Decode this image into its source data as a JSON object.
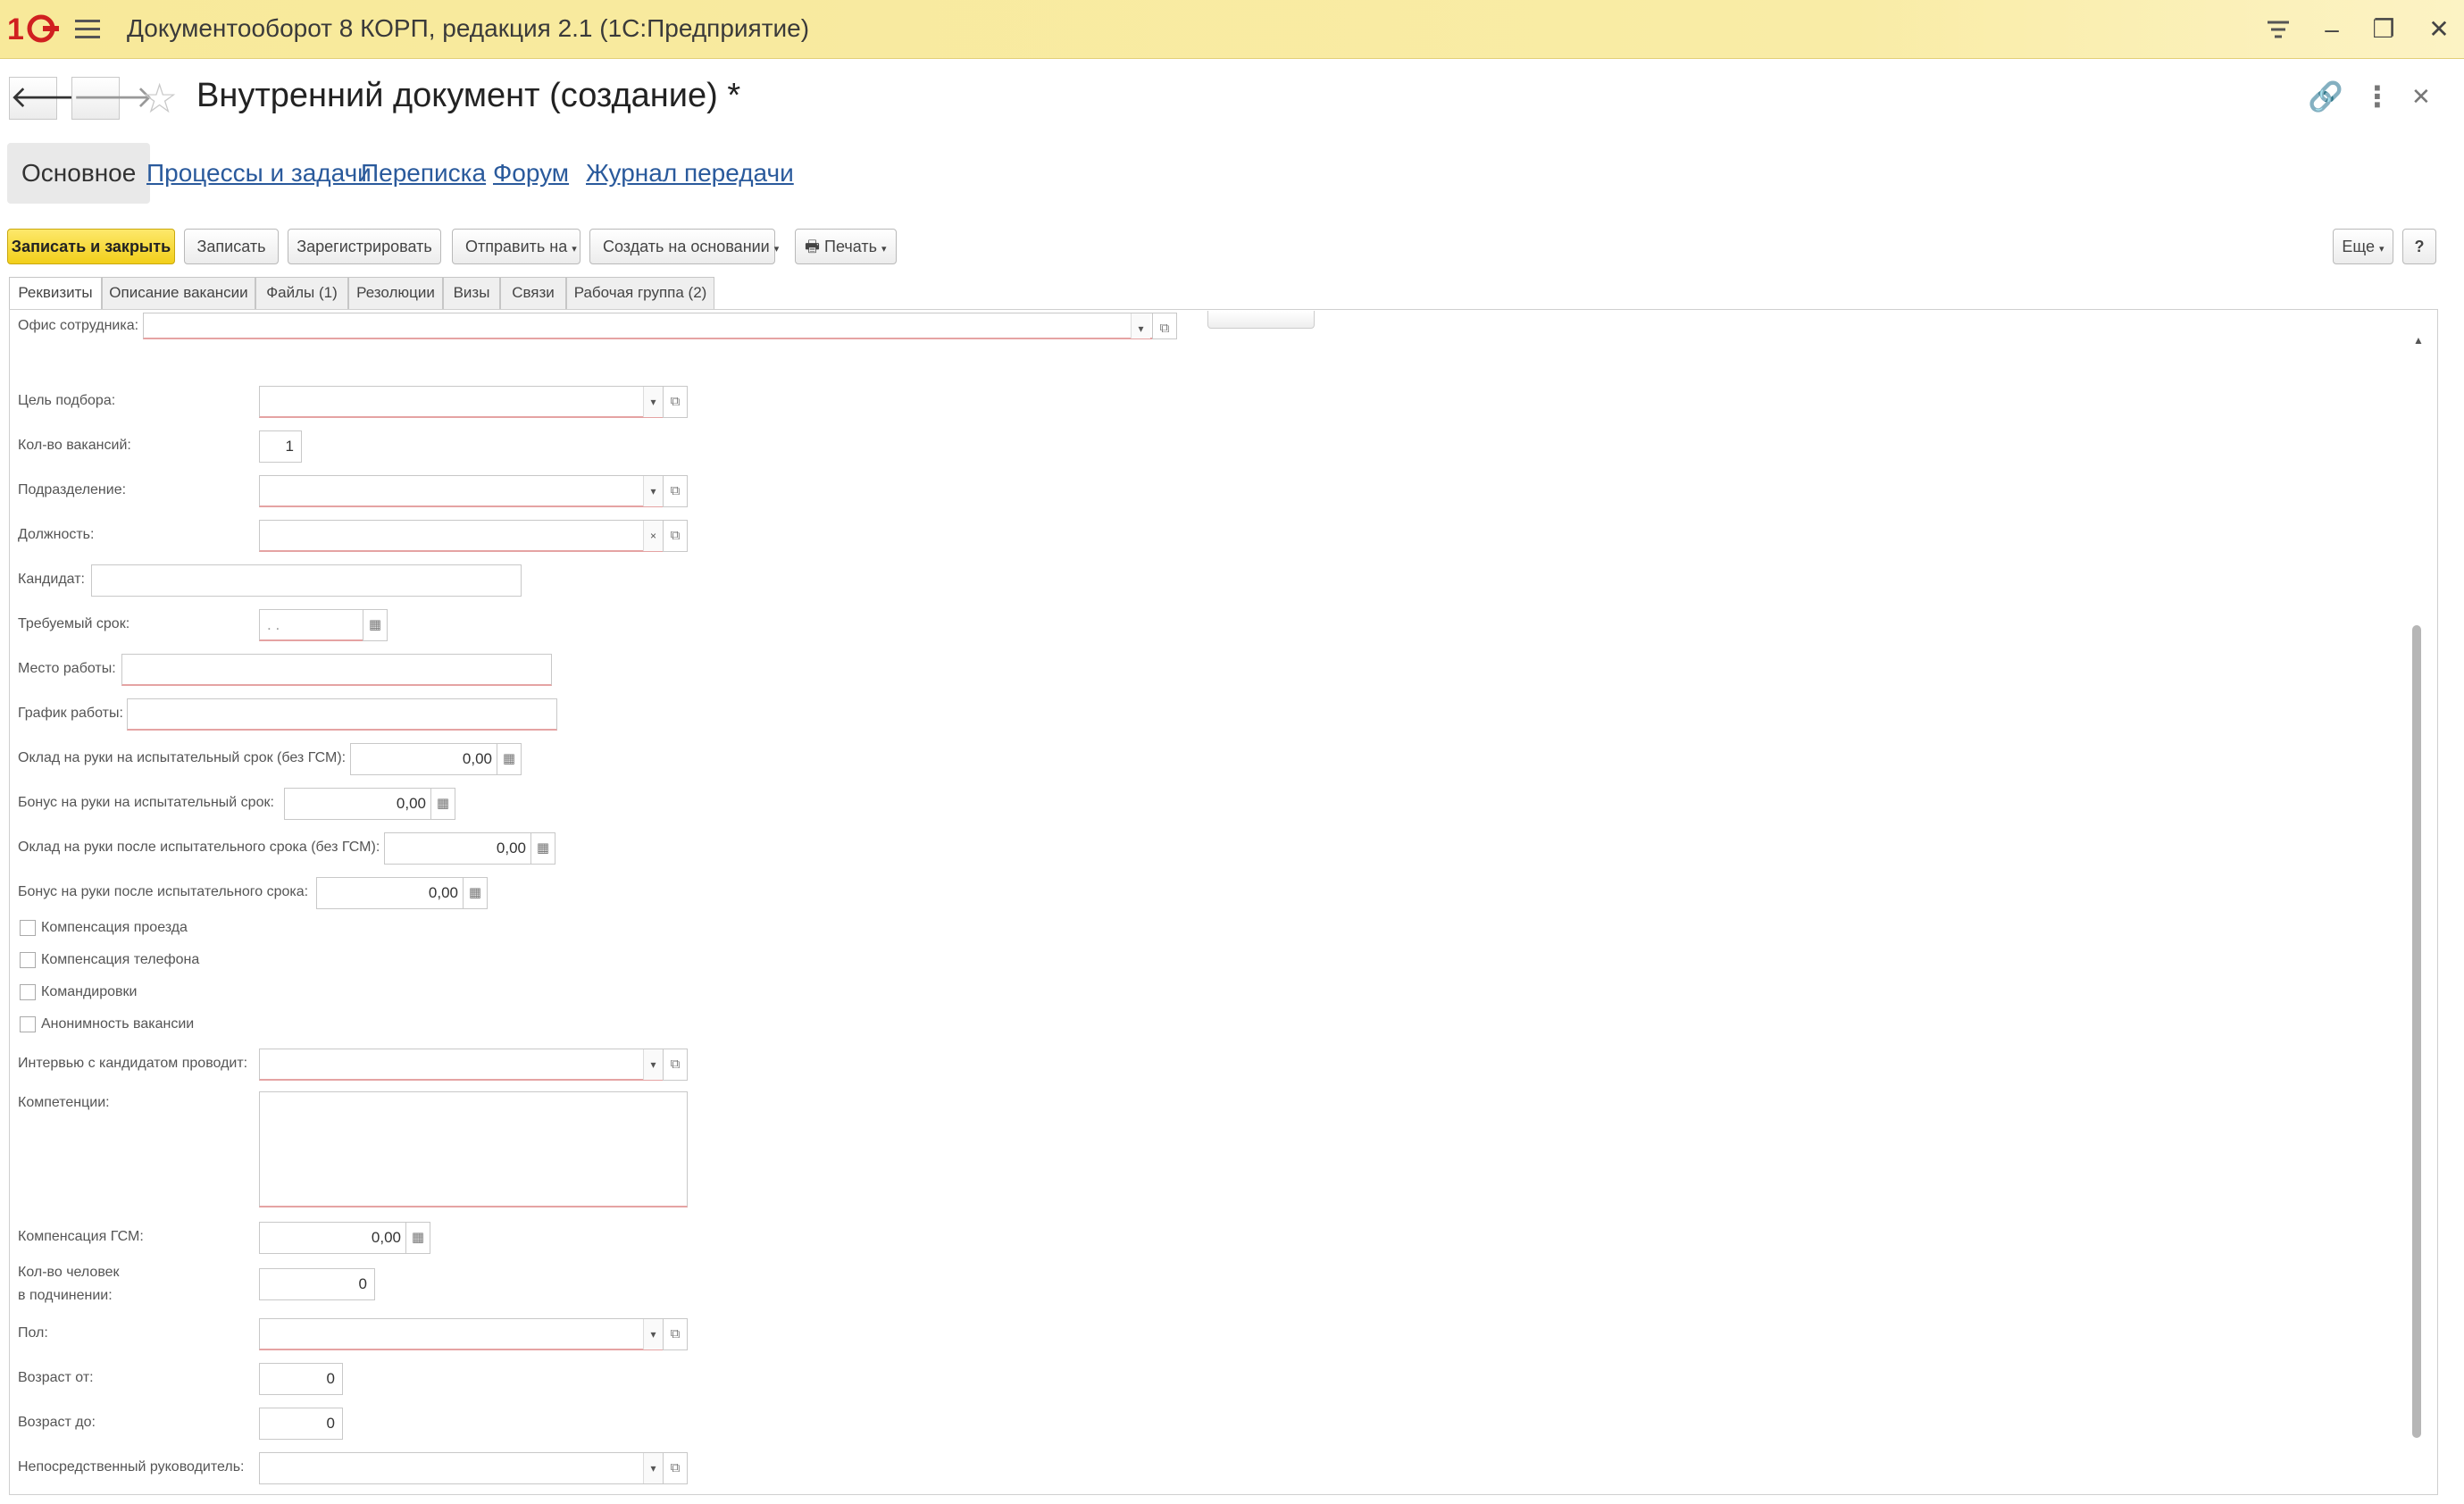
{
  "window": {
    "title": "Документооборот 8 КОРП, редакция 2.1  (1С:Предприятие)",
    "controls": [
      "hamburger-menu-icon",
      "minimize-icon",
      "restore-icon",
      "close-icon"
    ]
  },
  "header": {
    "title": "Внутренний документ (создание) *"
  },
  "section_tabs": [
    "Основное",
    "Процессы и задачи",
    "Переписка",
    "Форум",
    "Журнал передачи"
  ],
  "commands": {
    "save_close": "Записать и закрыть",
    "save": "Записать",
    "register": "Зарегистрировать",
    "send_to": "Отправить на",
    "create_based": "Создать на основании",
    "print": "Печать",
    "more": "Еще",
    "help": "?"
  },
  "form_tabs": [
    "Реквизиты",
    "Описание вакансии",
    "Файлы (1)",
    "Резолюции",
    "Визы",
    "Связи",
    "Рабочая группа (2)"
  ],
  "fields": {
    "office": {
      "label": "Офис сотрудника:",
      "value": ""
    },
    "goal": {
      "label": "Цель подбора:",
      "value": ""
    },
    "vacancies": {
      "label": "Кол-во вакансий:",
      "value": "1"
    },
    "department": {
      "label": "Подразделение:",
      "value": ""
    },
    "position": {
      "label": "Должность:",
      "value": ""
    },
    "candidate": {
      "label": "Кандидат:",
      "value": ""
    },
    "deadline": {
      "label": "Требуемый срок:",
      "value": " .  ."
    },
    "workplace": {
      "label": "Место работы:",
      "value": ""
    },
    "schedule": {
      "label": "График работы:",
      "value": ""
    },
    "salary_probation": {
      "label": "Оклад на руки на испытательный срок (без ГСМ):",
      "value": "0,00"
    },
    "bonus_probation": {
      "label": "Бонус на руки на испытательный срок:",
      "value": "0,00"
    },
    "salary_after": {
      "label": "Оклад на руки после испытательного срока (без ГСМ):",
      "value": "0,00"
    },
    "bonus_after": {
      "label": "Бонус на руки после испытательного срока:",
      "value": "0,00"
    },
    "checkboxes": [
      {
        "label": "Компенсация проезда",
        "checked": false
      },
      {
        "label": "Компенсация телефона",
        "checked": false
      },
      {
        "label": "Командировки",
        "checked": false
      },
      {
        "label": "Анонимность вакансии",
        "checked": false
      }
    ],
    "interviewer": {
      "label": "Интервью с кандидатом проводит:",
      "value": ""
    },
    "competencies": {
      "label": "Компетенции:",
      "value": ""
    },
    "fuel_comp": {
      "label": "Компенсация ГСМ:",
      "value": "0,00"
    },
    "subordinates": {
      "label_line1": "Кол-во человек",
      "label_line2": "в подчинении:",
      "value": "0"
    },
    "gender": {
      "label": "Пол:",
      "value": ""
    },
    "age_from": {
      "label": "Возраст от:",
      "value": "0"
    },
    "age_to": {
      "label": "Возраст до:",
      "value": "0"
    },
    "manager": {
      "label": "Непосредственный руководитель:",
      "value": ""
    }
  },
  "colors": {
    "titlebar": "#f8e99a",
    "primary_button": "#f2cf1a",
    "link": "#2a5a9c",
    "required_underline": "#e5a3a3"
  }
}
